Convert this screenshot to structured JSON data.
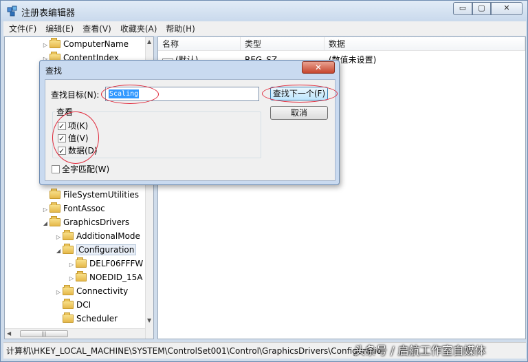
{
  "window": {
    "title": "注册表编辑器",
    "controls": {
      "minimize": "▭",
      "maximize": "▢",
      "close": "✕"
    }
  },
  "menu": [
    "文件(F)",
    "编辑(E)",
    "查看(V)",
    "收藏夹(A)",
    "帮助(H)"
  ],
  "tree": {
    "items": [
      {
        "label": "ComputerName",
        "expander": "▷",
        "selected": false
      },
      {
        "label": "ContentIndex",
        "expander": "▷",
        "selected": false
      },
      {
        "label": "FileSystemUtilities",
        "expander": "",
        "selected": false
      },
      {
        "label": "FontAssoc",
        "expander": "▷",
        "selected": false
      },
      {
        "label": "GraphicsDrivers",
        "expander": "◢",
        "selected": false
      },
      {
        "label": "AdditionalMode",
        "expander": "▷",
        "selected": false
      },
      {
        "label": "Configuration",
        "expander": "◢",
        "selected": true
      },
      {
        "label": "DELF06FFFW",
        "expander": "▷",
        "selected": false
      },
      {
        "label": "NOEDID_15A",
        "expander": "▷",
        "selected": false
      },
      {
        "label": "Connectivity",
        "expander": "▷",
        "selected": false
      },
      {
        "label": "DCI",
        "expander": "",
        "selected": false
      },
      {
        "label": "Scheduler",
        "expander": "",
        "selected": false
      }
    ]
  },
  "list": {
    "columns": [
      "名称",
      "类型",
      "数据"
    ],
    "rows": [
      {
        "name": "(默认)",
        "type": "REG_SZ",
        "data": "(数值未设置)"
      }
    ]
  },
  "dialog": {
    "title": "查找",
    "find_label": "查找目标(N):",
    "find_value": "Scaling",
    "find_next": "查找下一个(F)",
    "cancel": "取消",
    "group_label": "查看",
    "options": [
      {
        "label": "项(K)",
        "checked": true
      },
      {
        "label": "值(V)",
        "checked": true
      },
      {
        "label": "数据(D)",
        "checked": true
      }
    ],
    "whole_word": {
      "label": "全字匹配(W)",
      "checked": false
    }
  },
  "status": {
    "path": "计算机\\HKEY_LOCAL_MACHINE\\SYSTEM\\ControlSet001\\Control\\GraphicsDrivers\\Configuratio"
  },
  "watermark": "头条号 / 启航工作室自媒体",
  "colors": {
    "annotation": "#e0283a",
    "selection": "#3399ff"
  }
}
